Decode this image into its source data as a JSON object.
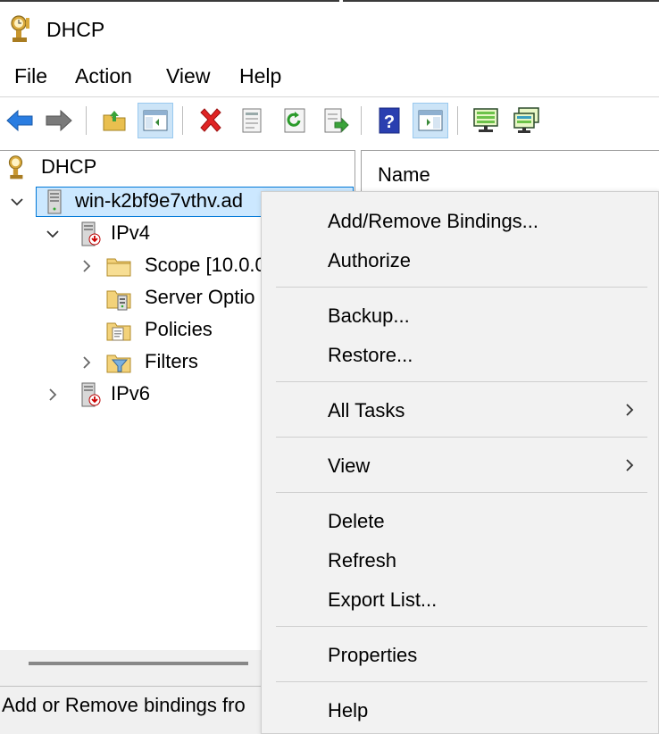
{
  "window": {
    "title": "DHCP",
    "app_icon": "dhcp-trophy-icon"
  },
  "menubar": {
    "items": [
      "File",
      "Action",
      "View",
      "Help"
    ]
  },
  "toolbar": {
    "buttons": [
      "back-arrow-icon",
      "forward-arrow-icon",
      "up-folder-icon",
      "show-hide-tree-icon",
      "delete-icon",
      "properties-icon",
      "refresh-icon",
      "export-list-icon",
      "help-icon",
      "show-action-pane-icon",
      "monitor-green-icon",
      "monitor-network-icon"
    ]
  },
  "tree": {
    "root": {
      "label": "DHCP",
      "icon": "dhcp-trophy-icon"
    },
    "server": {
      "label": "win-k2bf9e7vthv.ad",
      "icon": "server-icon"
    },
    "ipv4": {
      "label": "IPv4",
      "icon": "ipv4-server-icon"
    },
    "scope": {
      "label": "Scope [10.0.0",
      "icon": "folder-icon"
    },
    "server_options": {
      "label": "Server Optio",
      "icon": "server-options-icon"
    },
    "policies": {
      "label": "Policies",
      "icon": "policies-icon"
    },
    "filters": {
      "label": "Filters",
      "icon": "filter-icon"
    },
    "ipv6": {
      "label": "IPv6",
      "icon": "ipv6-server-icon"
    }
  },
  "list": {
    "header_name": "Name"
  },
  "status": {
    "text": "Add or Remove bindings fro"
  },
  "context_menu": {
    "add_remove_bindings": "Add/Remove Bindings...",
    "authorize": "Authorize",
    "backup": "Backup...",
    "restore": "Restore...",
    "all_tasks": "All Tasks",
    "view": "View",
    "delete": "Delete",
    "refresh": "Refresh",
    "export_list": "Export List...",
    "properties": "Properties",
    "help": "Help"
  },
  "colors": {
    "selection_fill": "#cce8ff",
    "selection_border": "#0078d7",
    "menu_background": "#f2f2f2",
    "toolbar_pressed": "#cce4f7"
  }
}
